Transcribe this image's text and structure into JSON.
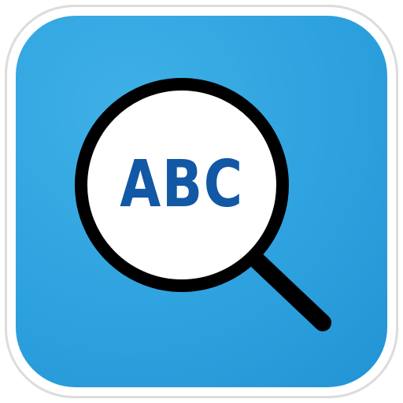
{
  "app_icon": {
    "lens_text": "ABC",
    "icon": "magnifying-glass-icon",
    "colors": {
      "tile_background": "#2ea2df",
      "lens_fill": "#ffffff",
      "lens_stroke": "#000000",
      "text": "#1258a5",
      "frame_border": "#dcdcdc"
    }
  }
}
